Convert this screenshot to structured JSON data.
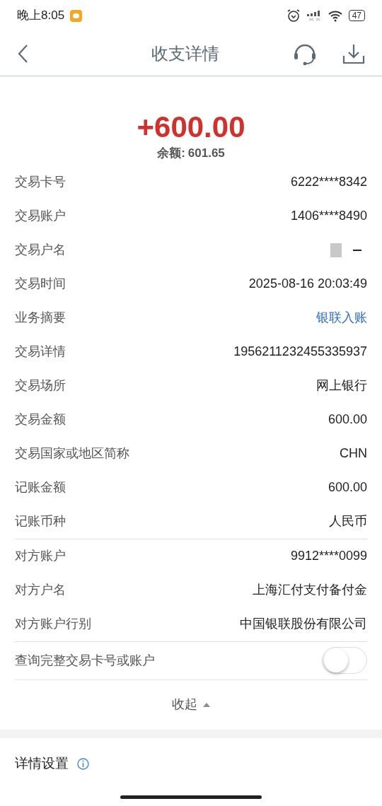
{
  "status_bar": {
    "time": "晚上8:05",
    "battery": "47"
  },
  "nav": {
    "title": "收支详情"
  },
  "summary": {
    "amount": "+600.00",
    "balance_label": "余额:",
    "balance": "601.65"
  },
  "groups": [
    {
      "rows": [
        {
          "label": "交易卡号",
          "value": "6222****8342",
          "kind": "text"
        },
        {
          "label": "交易账户",
          "value": "1406****8490",
          "kind": "text"
        },
        {
          "label": "交易户名",
          "kind": "redacted"
        },
        {
          "label": "交易时间",
          "value": "2025-08-16 20:03:49",
          "kind": "text"
        },
        {
          "label": "业务摘要",
          "value": "银联入账",
          "kind": "link"
        },
        {
          "label": "交易详情",
          "value": "1956211232455335937",
          "kind": "text"
        },
        {
          "label": "交易场所",
          "value": "网上银行",
          "kind": "text"
        },
        {
          "label": "交易金额",
          "value": "600.00",
          "kind": "text"
        },
        {
          "label": "交易国家或地区简称",
          "value": "CHN",
          "kind": "text"
        },
        {
          "label": "记账金额",
          "value": "600.00",
          "kind": "text"
        },
        {
          "label": "记账币种",
          "value": "人民币",
          "kind": "text"
        }
      ]
    },
    {
      "rows": [
        {
          "label": "对方账户",
          "value": "9912****0099",
          "kind": "text"
        },
        {
          "label": "对方户名",
          "value": "上海汇付支付备付金",
          "kind": "text"
        },
        {
          "label": "对方账户行别",
          "value": "中国银联股份有限公司",
          "kind": "text"
        }
      ]
    }
  ],
  "toggle": {
    "label": "查询完整交易卡号或账户",
    "on": false
  },
  "collapse": {
    "label": "收起"
  },
  "settings": {
    "label": "详情设置"
  }
}
